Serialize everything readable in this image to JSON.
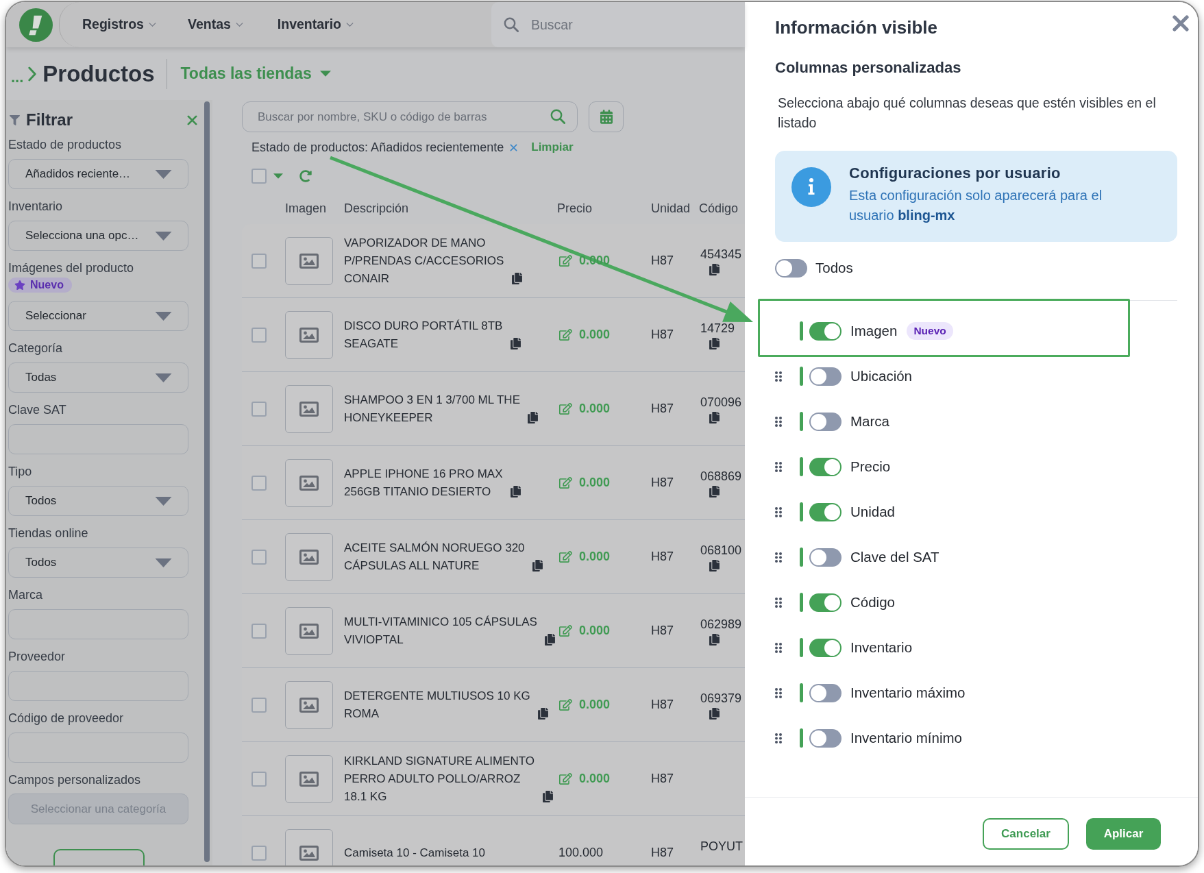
{
  "top_nav": {
    "menus": [
      {
        "label": "Registros"
      },
      {
        "label": "Ventas"
      },
      {
        "label": "Inventario"
      }
    ],
    "search": {
      "placeholder": "Buscar"
    }
  },
  "breadcrumb": {
    "ellipsis": "...",
    "title": "Productos",
    "store_selector": "Todas las tiendas"
  },
  "filter_sidebar": {
    "title": "Filtrar",
    "fields": [
      {
        "label": "Estado de productos",
        "kind": "select",
        "value": "Añadidos reciente…",
        "disabled": false
      },
      {
        "label": "Inventario",
        "kind": "select",
        "value": "Selecciona una opc…",
        "disabled": false
      },
      {
        "label": "Imágenes del producto",
        "badge": "Nuevo",
        "kind": "select",
        "value": "Seleccionar",
        "disabled": false
      },
      {
        "label": "Categoría",
        "kind": "select",
        "value": "Todas",
        "disabled": false
      },
      {
        "label": "Clave SAT",
        "kind": "input",
        "disabled": false
      },
      {
        "label": "Tipo",
        "kind": "select",
        "value": "Todos",
        "disabled": false
      },
      {
        "label": "Tiendas online",
        "kind": "select",
        "value": "Todos",
        "disabled": false
      },
      {
        "label": "Marca",
        "kind": "input",
        "disabled": false
      },
      {
        "label": "Proveedor",
        "kind": "input",
        "disabled": false
      },
      {
        "label": "Código de proveedor",
        "kind": "input",
        "disabled": false
      },
      {
        "label": "Campos personalizados",
        "kind": "select",
        "placeholder": "Seleccionar una categoría",
        "disabled": true
      }
    ]
  },
  "product_list": {
    "search": {
      "placeholder": "Buscar por nombre, SKU o código de barras"
    },
    "active_filter": {
      "text": "Estado de productos: Añadidos recientemente",
      "clear": "Limpiar"
    },
    "select_all": {
      "checked": false
    },
    "columns": [
      "Imagen",
      "Descripción",
      "Precio",
      "Unidad",
      "Código"
    ],
    "rows": [
      {
        "checked": false,
        "description": "VAPORIZADOR DE MANO P/PRENDAS C/ACCESORIOS CONAIR",
        "copyable": true,
        "price": "0.000",
        "price_editable": true,
        "unit": "H87",
        "code": "454345"
      },
      {
        "checked": false,
        "description": "DISCO DURO PORTÁTIL 8TB SEAGATE",
        "copyable": true,
        "price": "0.000",
        "price_editable": true,
        "unit": "H87",
        "code": "14729"
      },
      {
        "checked": false,
        "description": "SHAMPOO 3 EN 1 3/700 ML THE HONEYKEEPER",
        "copyable": true,
        "price": "0.000",
        "price_editable": true,
        "unit": "H87",
        "code": "070096"
      },
      {
        "checked": false,
        "description": "APPLE IPHONE 16 PRO MAX 256GB TITANIO DESIERTO",
        "copyable": true,
        "price": "0.000",
        "price_editable": true,
        "unit": "H87",
        "code": "068869"
      },
      {
        "checked": false,
        "description": "ACEITE SALMÓN NORUEGO 320 CÁPSULAS ALL NATURE",
        "copyable": true,
        "price": "0.000",
        "price_editable": true,
        "unit": "H87",
        "code": "068100"
      },
      {
        "checked": false,
        "description": "MULTI-VITAMINICO 105 CÁPSULAS VIVIOPTAL",
        "copyable": true,
        "price": "0.000",
        "price_editable": true,
        "unit": "H87",
        "code": "062989"
      },
      {
        "checked": false,
        "description": "DETERGENTE MULTIUSOS 10 KG ROMA",
        "copyable": true,
        "price": "0.000",
        "price_editable": true,
        "unit": "H87",
        "code": "069379"
      },
      {
        "checked": false,
        "description": "KIRKLAND SIGNATURE ALIMENTO PERRO ADULTO POLLO/ARROZ 18.1 KG",
        "copyable": true,
        "price": "0.000",
        "price_editable": true,
        "unit": "H87"
      },
      {
        "checked": false,
        "description": "Camiseta 10 - Camiseta 10",
        "copyable": false,
        "price": "100.000",
        "price_editable": false,
        "unit": "H87",
        "code": "POYUT"
      }
    ]
  },
  "visible_columns_panel": {
    "title": "Información visible",
    "subtitle": "Columnas personalizadas",
    "description": "Selecciona abajo qué columnas deseas que estén visibles en el listado",
    "info": {
      "title": "Configuraciones por usuario",
      "text": "Esta configuración solo aparecerá para el usuario **bling-mx**"
    },
    "select_all": {
      "label": "Todos",
      "on": false
    },
    "columns": [
      {
        "label": "Imagen",
        "badge": "Nuevo",
        "on": true,
        "draggable": false,
        "highlighted": true
      },
      {
        "label": "Ubicación",
        "on": false,
        "draggable": true,
        "highlighted": false
      },
      {
        "label": "Marca",
        "on": false,
        "draggable": true,
        "highlighted": false
      },
      {
        "label": "Precio",
        "on": true,
        "draggable": true,
        "highlighted": false
      },
      {
        "label": "Unidad",
        "on": true,
        "draggable": true,
        "highlighted": false
      },
      {
        "label": "Clave del SAT",
        "on": false,
        "draggable": true,
        "highlighted": false
      },
      {
        "label": "Código",
        "on": true,
        "draggable": true,
        "highlighted": false
      },
      {
        "label": "Inventario",
        "on": true,
        "draggable": true,
        "highlighted": false
      },
      {
        "label": "Inventario máximo",
        "on": false,
        "draggable": true,
        "highlighted": false
      },
      {
        "label": "Inventario mínimo",
        "on": false,
        "draggable": true,
        "highlighted": false
      }
    ],
    "buttons": [
      {
        "label": "Cancelar",
        "kind": "secondary"
      },
      {
        "label": "Aplicar",
        "kind": "primary"
      }
    ]
  }
}
